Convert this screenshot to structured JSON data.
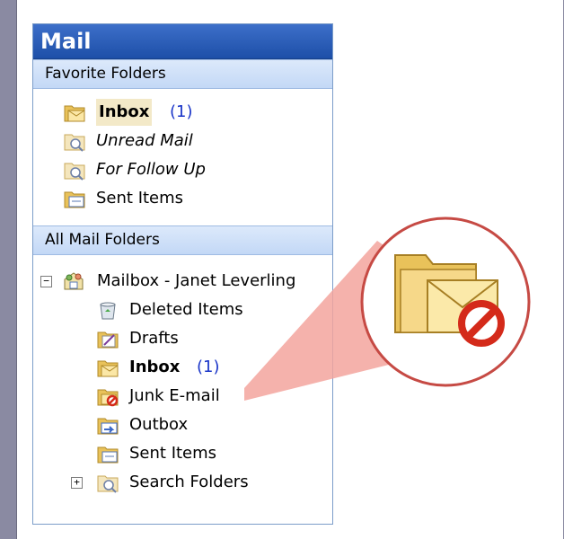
{
  "pane": {
    "title": "Mail",
    "favorite_header": "Favorite Folders",
    "all_header": "All Mail Folders"
  },
  "favorites": [
    {
      "label": "Inbox",
      "count": "(1)",
      "icon": "inbox-folder-icon",
      "style": "bold"
    },
    {
      "label": "Unread Mail",
      "count": "",
      "icon": "search-folder-icon",
      "style": "italic"
    },
    {
      "label": "For Follow Up",
      "count": "",
      "icon": "search-folder-icon",
      "style": "italic"
    },
    {
      "label": "Sent Items",
      "count": "",
      "icon": "sent-items-icon",
      "style": "normal"
    }
  ],
  "mailbox": {
    "label": "Mailbox - Janet Leverling",
    "icon": "mailbox-icon",
    "expander": "−"
  },
  "folders": [
    {
      "label": "Deleted Items",
      "count": "",
      "icon": "deleted-items-icon",
      "style": "normal"
    },
    {
      "label": "Drafts",
      "count": "",
      "icon": "drafts-folder-icon",
      "style": "normal"
    },
    {
      "label": "Inbox",
      "count": "(1)",
      "icon": "inbox-folder-icon",
      "style": "bold"
    },
    {
      "label": "Junk E-mail",
      "count": "",
      "icon": "junk-email-icon",
      "style": "normal"
    },
    {
      "label": "Outbox",
      "count": "",
      "icon": "outbox-icon",
      "style": "normal"
    },
    {
      "label": "Sent Items",
      "count": "",
      "icon": "sent-items-icon",
      "style": "normal"
    },
    {
      "label": "Search Folders",
      "count": "",
      "icon": "search-folder-icon",
      "style": "normal",
      "expander": "+"
    }
  ],
  "callout": {
    "icon": "junk-email-large-icon"
  },
  "colors": {
    "title_bar": "#2a5cb8",
    "header": "#c9dbf7",
    "count": "#1a35c8",
    "callout": "#f4a6a0"
  }
}
